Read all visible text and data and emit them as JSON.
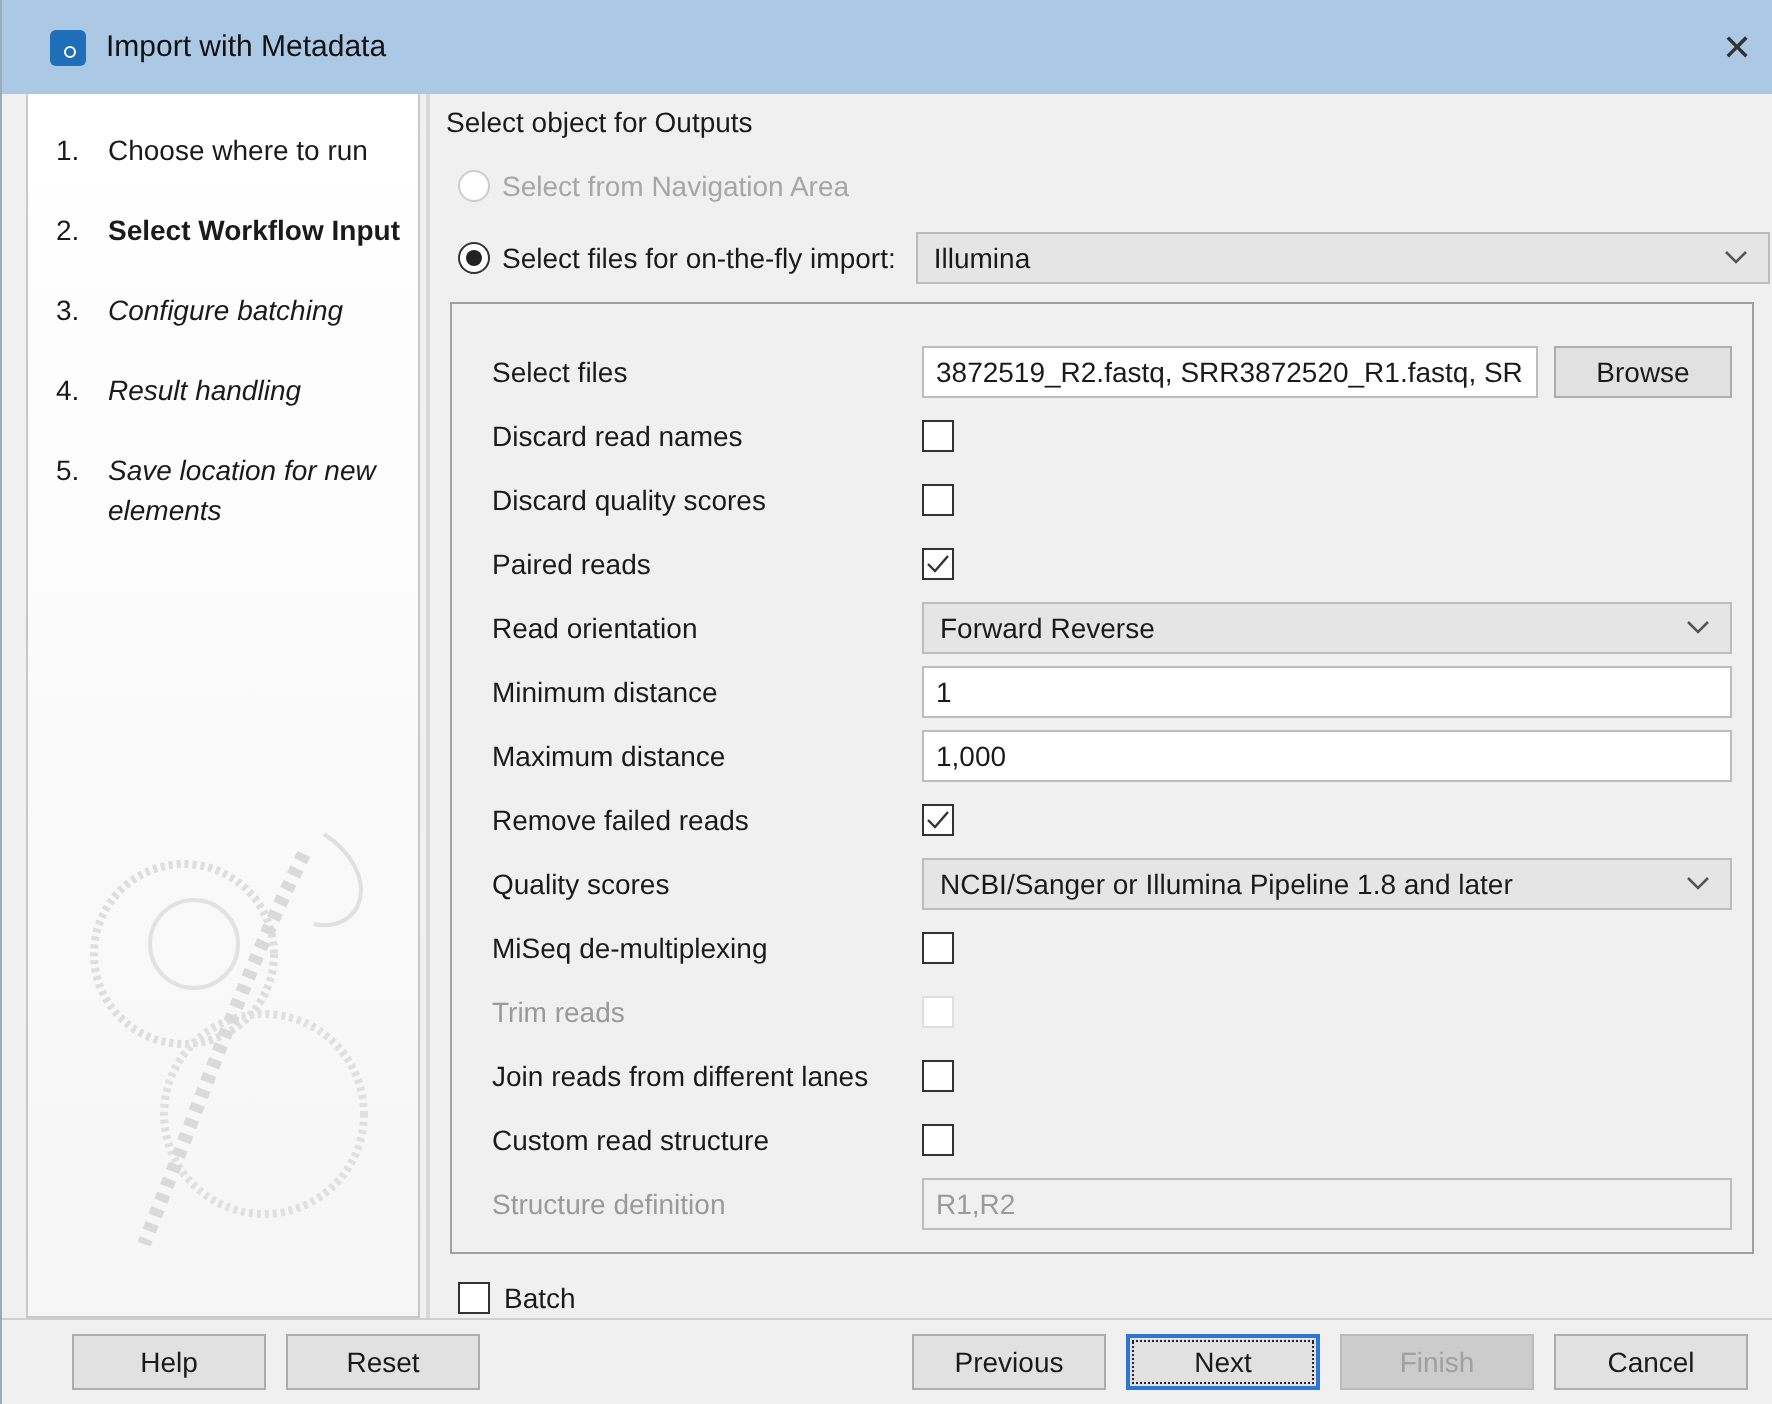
{
  "window": {
    "title": "Import with Metadata",
    "close": "✕"
  },
  "steps": [
    {
      "number": "1.",
      "label": "Choose where to run",
      "selected": false,
      "upcoming": false
    },
    {
      "number": "2.",
      "label": "Select Workflow Input",
      "selected": true,
      "upcoming": false
    },
    {
      "number": "3.",
      "label": "Configure batching",
      "selected": false,
      "upcoming": true
    },
    {
      "number": "4.",
      "label": "Result handling",
      "selected": false,
      "upcoming": true
    },
    {
      "number": "5.",
      "label": "Save location for new elements",
      "selected": false,
      "upcoming": true
    }
  ],
  "section_title": "Select object for Outputs",
  "source_options": [
    {
      "label": "Select from Navigation Area",
      "selected": false,
      "disabled": true
    },
    {
      "label": "Select files for on-the-fly import:",
      "selected": true,
      "disabled": false
    }
  ],
  "format_dropdown": {
    "value": "Illumina"
  },
  "fields": [
    {
      "kind": "file",
      "label": "Select files",
      "disabled": false,
      "value": "3872519_R2.fastq, SRR3872520_R1.fastq, SR",
      "button": "Browse"
    },
    {
      "kind": "checkbox",
      "label": "Discard read names",
      "disabled": false,
      "checked": false
    },
    {
      "kind": "checkbox",
      "label": "Discard quality scores",
      "disabled": false,
      "checked": false
    },
    {
      "kind": "checkbox",
      "label": "Paired reads",
      "disabled": false,
      "checked": true
    },
    {
      "kind": "dropdown",
      "label": "Read orientation",
      "disabled": false,
      "value": "Forward Reverse"
    },
    {
      "kind": "text",
      "label": "Minimum distance",
      "disabled": false,
      "value": "1"
    },
    {
      "kind": "text",
      "label": "Maximum distance",
      "disabled": false,
      "value": "1,000"
    },
    {
      "kind": "checkbox",
      "label": "Remove failed reads",
      "disabled": false,
      "checked": true
    },
    {
      "kind": "dropdown",
      "label": "Quality scores",
      "disabled": false,
      "value": "NCBI/Sanger or Illumina Pipeline 1.8 and later"
    },
    {
      "kind": "checkbox",
      "label": "MiSeq de-multiplexing",
      "disabled": false,
      "checked": false
    },
    {
      "kind": "checkbox",
      "label": "Trim reads",
      "disabled": true,
      "checked": false
    },
    {
      "kind": "checkbox",
      "label": "Join reads from different lanes",
      "disabled": false,
      "checked": false
    },
    {
      "kind": "checkbox",
      "label": "Custom read structure",
      "disabled": false,
      "checked": false
    },
    {
      "kind": "text",
      "label": "Structure definition",
      "disabled": true,
      "value": "R1,R2"
    }
  ],
  "batch": {
    "label": "Batch",
    "checked": false
  },
  "buttons_left": [
    {
      "label": "Help",
      "disabled": false,
      "focused": false
    },
    {
      "label": "Reset",
      "disabled": false,
      "focused": false
    }
  ],
  "buttons_right": [
    {
      "label": "Previous",
      "disabled": false,
      "focused": false
    },
    {
      "label": "Next",
      "disabled": false,
      "focused": true
    },
    {
      "label": "Finish",
      "disabled": true,
      "focused": false
    },
    {
      "label": "Cancel",
      "disabled": false,
      "focused": false
    }
  ]
}
